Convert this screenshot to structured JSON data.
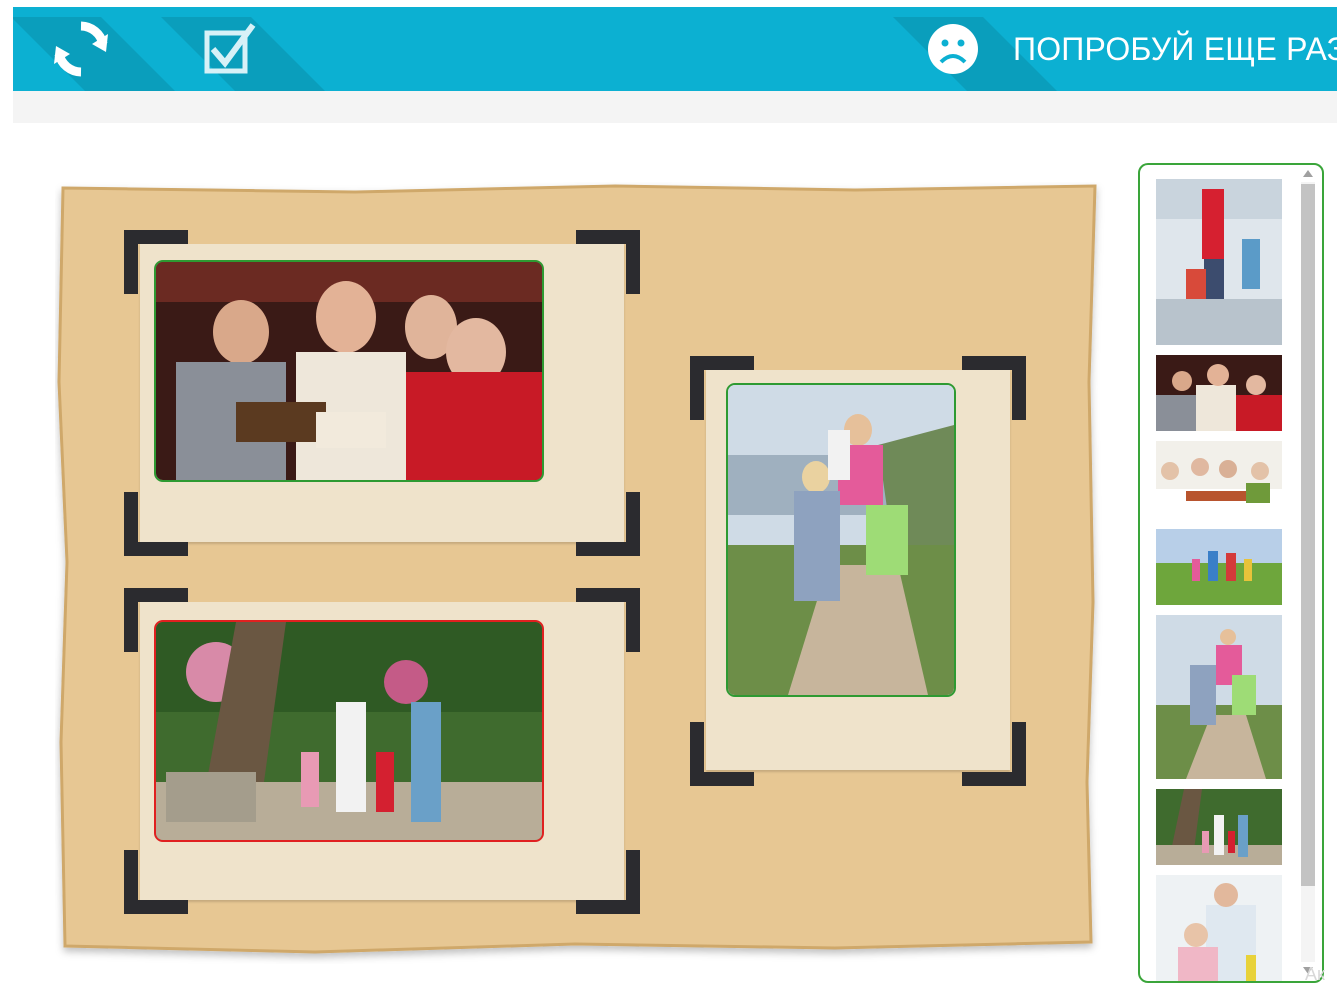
{
  "toolbar": {
    "background": "#0cb0d2",
    "refresh_icon": "refresh-icon",
    "check_icon": "checkbox-icon",
    "status_icon": "sad-face-icon",
    "status_text": "ПОПРОБУЙ ЕЩЕ РАЗ!"
  },
  "board": {
    "background": "#e7c793",
    "placed_photos": [
      {
        "slot": 1,
        "description": "family-reading-book",
        "result": "correct",
        "border_color": "#2e9a32"
      },
      {
        "slot": 2,
        "description": "family-walking-park",
        "result": "incorrect",
        "border_color": "#e02020"
      },
      {
        "slot": 3,
        "description": "family-hiking-coast",
        "result": "correct",
        "border_color": "#2e9a32"
      }
    ]
  },
  "photo_panel": {
    "border_color": "#3aa53a",
    "thumbnails": [
      "mother-children-shopping",
      "family-reading-book",
      "family-dinner-table",
      "family-running-field",
      "family-hiking-coast",
      "family-walking-park",
      "father-daughter-kitchen"
    ]
  },
  "watermark": "Ак"
}
